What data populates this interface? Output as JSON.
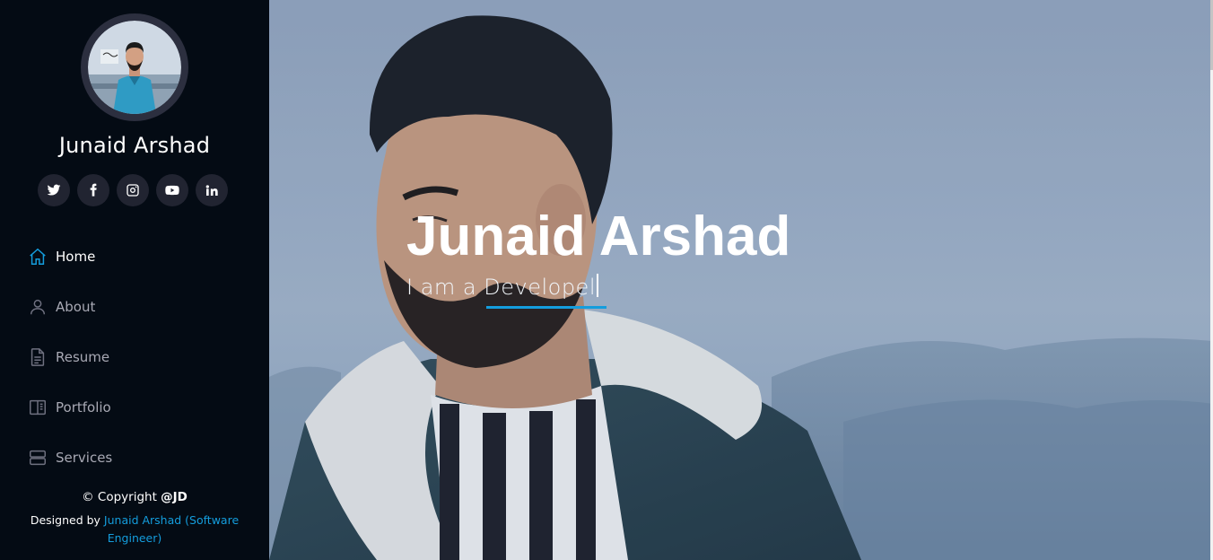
{
  "profile": {
    "name": "Junaid Arshad"
  },
  "social": [
    {
      "icon": "twitter-icon"
    },
    {
      "icon": "facebook-icon"
    },
    {
      "icon": "instagram-icon"
    },
    {
      "icon": "youtube-icon"
    },
    {
      "icon": "linkedin-icon"
    }
  ],
  "nav": {
    "items": [
      {
        "label": "Home",
        "icon": "home-icon",
        "active": true
      },
      {
        "label": "About",
        "icon": "person-icon"
      },
      {
        "label": "Resume",
        "icon": "file-text-icon"
      },
      {
        "label": "Portfolio",
        "icon": "book-icon"
      },
      {
        "label": "Services",
        "icon": "server-icon"
      }
    ]
  },
  "footer": {
    "copyright_prefix": "© Copyright ",
    "copyright_owner": "@JD",
    "designed_by": "Designed by ",
    "designer_link": "Junaid Arshad (Software Engineer)"
  },
  "hero": {
    "title": "Junaid Arshad",
    "subtitle_typed": "I am a Developel"
  },
  "colors": {
    "sidebar_bg": "#040b14",
    "accent": "#149ddd",
    "social_btn_bg": "#212431"
  }
}
